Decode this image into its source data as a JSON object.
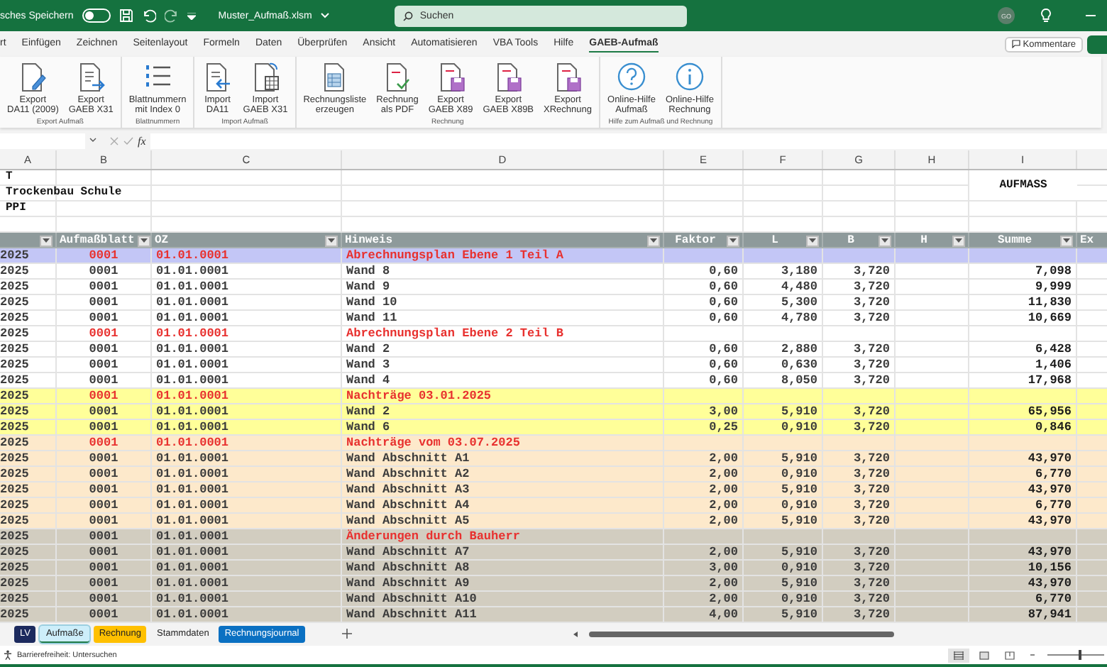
{
  "title_bar": {
    "autosave_label": "sches Speichern",
    "autosave_on": false,
    "file_name": "Muster_Aufmaß.xlsm",
    "search": {
      "placeholder": "Suchen"
    },
    "avatar": "GO"
  },
  "menu_tabs": [
    {
      "label": "rt",
      "selected": false
    },
    {
      "label": "Einfügen",
      "selected": false
    },
    {
      "label": "Zeichnen",
      "selected": false
    },
    {
      "label": "Seitenlayout",
      "selected": false
    },
    {
      "label": "Formeln",
      "selected": false
    },
    {
      "label": "Daten",
      "selected": false
    },
    {
      "label": "Überprüfen",
      "selected": false
    },
    {
      "label": "Ansicht",
      "selected": false
    },
    {
      "label": "Automatisieren",
      "selected": false
    },
    {
      "label": "VBA Tools",
      "selected": false
    },
    {
      "label": "Hilfe",
      "selected": false
    },
    {
      "label": "GAEB-Aufmaß",
      "selected": true
    }
  ],
  "comments_button": "Kommentare",
  "ribbon_groups": [
    {
      "label": "Export Aufmaß",
      "buttons": [
        {
          "kind": "edit",
          "label": "Export\nDA11 (2009)"
        },
        {
          "kind": "export",
          "label": "Export\nGAEB X31"
        }
      ]
    },
    {
      "label": "Blattnummern",
      "buttons": [
        {
          "kind": "numbers",
          "label": "Blattnummern\nmit Index 0"
        }
      ]
    },
    {
      "label": "Import Aufmaß",
      "buttons": [
        {
          "kind": "import",
          "label": "Import\nDA11"
        },
        {
          "kind": "table",
          "label": "Import\nGAEB X31"
        }
      ]
    },
    {
      "label": "Rechnung",
      "buttons": [
        {
          "kind": "sheet",
          "label": "Rechnungsliste\nerzeugen"
        },
        {
          "kind": "check",
          "label": "Rechnung\nals PDF"
        },
        {
          "kind": "save",
          "label": "Export\nGAEB X89"
        },
        {
          "kind": "save",
          "label": "Export\nGAEB X89B"
        },
        {
          "kind": "save",
          "label": "Export\nXRechnung"
        }
      ]
    },
    {
      "label": "Hilfe zum Aufmaß und Rechnung",
      "buttons": [
        {
          "kind": "help",
          "label": "Online-Hilfe\nAufmaß"
        },
        {
          "kind": "info",
          "label": "Online-Hilfe\nRechnung"
        }
      ]
    }
  ],
  "formula_bar": {
    "function_label": "fx"
  },
  "sheet": {
    "columns": [
      "A",
      "B",
      "C",
      "D",
      "E",
      "F",
      "G",
      "H",
      "I"
    ],
    "info_lines": [
      "T",
      "Trockenbau Schule",
      "PPI"
    ],
    "title": "AUFMASS",
    "header": [
      "Aufmaßblatt",
      "OZ",
      "Hinweis",
      "Faktor",
      "L",
      "B",
      "H",
      "Summe",
      "Ex"
    ],
    "rows": [
      {
        "kind": "heading",
        "color": "#c3c6f6",
        "year": "2025",
        "sheet": "0001",
        "oz": "01.01.0001",
        "note": "Abrechnungsplan Ebene 1 Teil A"
      },
      {
        "kind": "item",
        "color": "#ffffff",
        "year": "2025",
        "sheet": "0001",
        "oz": "01.01.0001",
        "note": "Wand 8",
        "factor": "0,60",
        "l": "3,180",
        "b": "3,720",
        "sum": "7,098"
      },
      {
        "kind": "item",
        "color": "#ffffff",
        "year": "2025",
        "sheet": "0001",
        "oz": "01.01.0001",
        "note": "Wand 9",
        "factor": "0,60",
        "l": "4,480",
        "b": "3,720",
        "sum": "9,999"
      },
      {
        "kind": "item",
        "color": "#ffffff",
        "year": "2025",
        "sheet": "0001",
        "oz": "01.01.0001",
        "note": "Wand 10",
        "factor": "0,60",
        "l": "5,300",
        "b": "3,720",
        "sum": "11,830"
      },
      {
        "kind": "item",
        "color": "#ffffff",
        "year": "2025",
        "sheet": "0001",
        "oz": "01.01.0001",
        "note": "Wand 11",
        "factor": "0,60",
        "l": "4,780",
        "b": "3,720",
        "sum": "10,669"
      },
      {
        "kind": "heading",
        "color": "#ffffff",
        "year": "2025",
        "sheet": "0001",
        "oz": "01.01.0001",
        "note": "Abrechnungsplan Ebene 2 Teil B"
      },
      {
        "kind": "item",
        "color": "#ffffff",
        "year": "2025",
        "sheet": "0001",
        "oz": "01.01.0001",
        "note": "Wand 2",
        "factor": "0,60",
        "l": "2,880",
        "b": "3,720",
        "sum": "6,428"
      },
      {
        "kind": "item",
        "color": "#ffffff",
        "year": "2025",
        "sheet": "0001",
        "oz": "01.01.0001",
        "note": "Wand 3",
        "factor": "0,60",
        "l": "0,630",
        "b": "3,720",
        "sum": "1,406"
      },
      {
        "kind": "item",
        "color": "#ffffff",
        "year": "2025",
        "sheet": "0001",
        "oz": "01.01.0001",
        "note": "Wand 4",
        "factor": "0,60",
        "l": "8,050",
        "b": "3,720",
        "sum": "17,968"
      },
      {
        "kind": "heading",
        "color": "#ffff99",
        "year": "2025",
        "sheet": "0001",
        "oz": "01.01.0001",
        "note": "Nachträge 03.01.2025"
      },
      {
        "kind": "item",
        "color": "#ffff99",
        "year": "2025",
        "sheet": "0001",
        "oz": "01.01.0001",
        "note": "Wand 2",
        "factor": "3,00",
        "l": "5,910",
        "b": "3,720",
        "sum": "65,956"
      },
      {
        "kind": "item",
        "color": "#ffff99",
        "year": "2025",
        "sheet": "0001",
        "oz": "01.01.0001",
        "note": "Wand 6",
        "factor": "0,25",
        "l": "0,910",
        "b": "3,720",
        "sum": "0,846"
      },
      {
        "kind": "heading",
        "color": "#fde9cb",
        "year": "2025",
        "sheet": "0001",
        "oz": "01.01.0001",
        "note": "Nachträge vom 03.07.2025"
      },
      {
        "kind": "item",
        "color": "#fde9cb",
        "year": "2025",
        "sheet": "0001",
        "oz": "01.01.0001",
        "note": "Wand Abschnitt A1",
        "factor": "2,00",
        "l": "5,910",
        "b": "3,720",
        "sum": "43,970"
      },
      {
        "kind": "item",
        "color": "#fde9cb",
        "year": "2025",
        "sheet": "0001",
        "oz": "01.01.0001",
        "note": "Wand Abschnitt A2",
        "factor": "2,00",
        "l": "0,910",
        "b": "3,720",
        "sum": "6,770"
      },
      {
        "kind": "item",
        "color": "#fde9cb",
        "year": "2025",
        "sheet": "0001",
        "oz": "01.01.0001",
        "note": "Wand Abschnitt A3",
        "factor": "2,00",
        "l": "5,910",
        "b": "3,720",
        "sum": "43,970"
      },
      {
        "kind": "item",
        "color": "#fde9cb",
        "year": "2025",
        "sheet": "0001",
        "oz": "01.01.0001",
        "note": "Wand Abschnitt A4",
        "factor": "2,00",
        "l": "0,910",
        "b": "3,720",
        "sum": "6,770"
      },
      {
        "kind": "item",
        "color": "#fde9cb",
        "year": "2025",
        "sheet": "0001",
        "oz": "01.01.0001",
        "note": "Wand Abschnitt A5",
        "factor": "2,00",
        "l": "5,910",
        "b": "3,720",
        "sum": "43,970"
      },
      {
        "kind": "note",
        "color": "#d2cdc0",
        "year": "2025",
        "sheet": "0001",
        "oz": "01.01.0001",
        "note": "Änderungen durch Bauherr"
      },
      {
        "kind": "item",
        "color": "#d2cdc0",
        "year": "2025",
        "sheet": "0001",
        "oz": "01.01.0001",
        "note": "Wand Abschnitt A7",
        "factor": "2,00",
        "l": "5,910",
        "b": "3,720",
        "sum": "43,970"
      },
      {
        "kind": "item",
        "color": "#d2cdc0",
        "year": "2025",
        "sheet": "0001",
        "oz": "01.01.0001",
        "note": "Wand Abschnitt A8",
        "factor": "3,00",
        "l": "0,910",
        "b": "3,720",
        "sum": "10,156"
      },
      {
        "kind": "item",
        "color": "#d2cdc0",
        "year": "2025",
        "sheet": "0001",
        "oz": "01.01.0001",
        "note": "Wand Abschnitt A9",
        "factor": "2,00",
        "l": "5,910",
        "b": "3,720",
        "sum": "43,970"
      },
      {
        "kind": "item",
        "color": "#d2cdc0",
        "year": "2025",
        "sheet": "0001",
        "oz": "01.01.0001",
        "note": "Wand Abschnitt A10",
        "factor": "2,00",
        "l": "0,910",
        "b": "3,720",
        "sum": "6,770"
      },
      {
        "kind": "item",
        "color": "#d2cdc0",
        "year": "2025",
        "sheet": "0001",
        "oz": "01.01.0001",
        "note": "Wand Abschnitt A11",
        "factor": "4,00",
        "l": "5,910",
        "b": "3,720",
        "sum": "87,941"
      }
    ]
  },
  "sheet_tabs": [
    {
      "label": "LV",
      "color": "#1c2a5e",
      "selected": false
    },
    {
      "label": "Aufmaße",
      "color": "#cdeefa",
      "selected": true
    },
    {
      "label": "Rechnung",
      "color": "#ffc000",
      "selected": false
    },
    {
      "label": "Stammdaten",
      "selected": false
    },
    {
      "label": "Rechnungsjournal",
      "color": "#0a70c2",
      "selected": false
    }
  ],
  "status_bar": {
    "accessibility": "Barrierefreiheit: Untersuchen",
    "zoom_slider": {
      "level": 0.55
    }
  }
}
